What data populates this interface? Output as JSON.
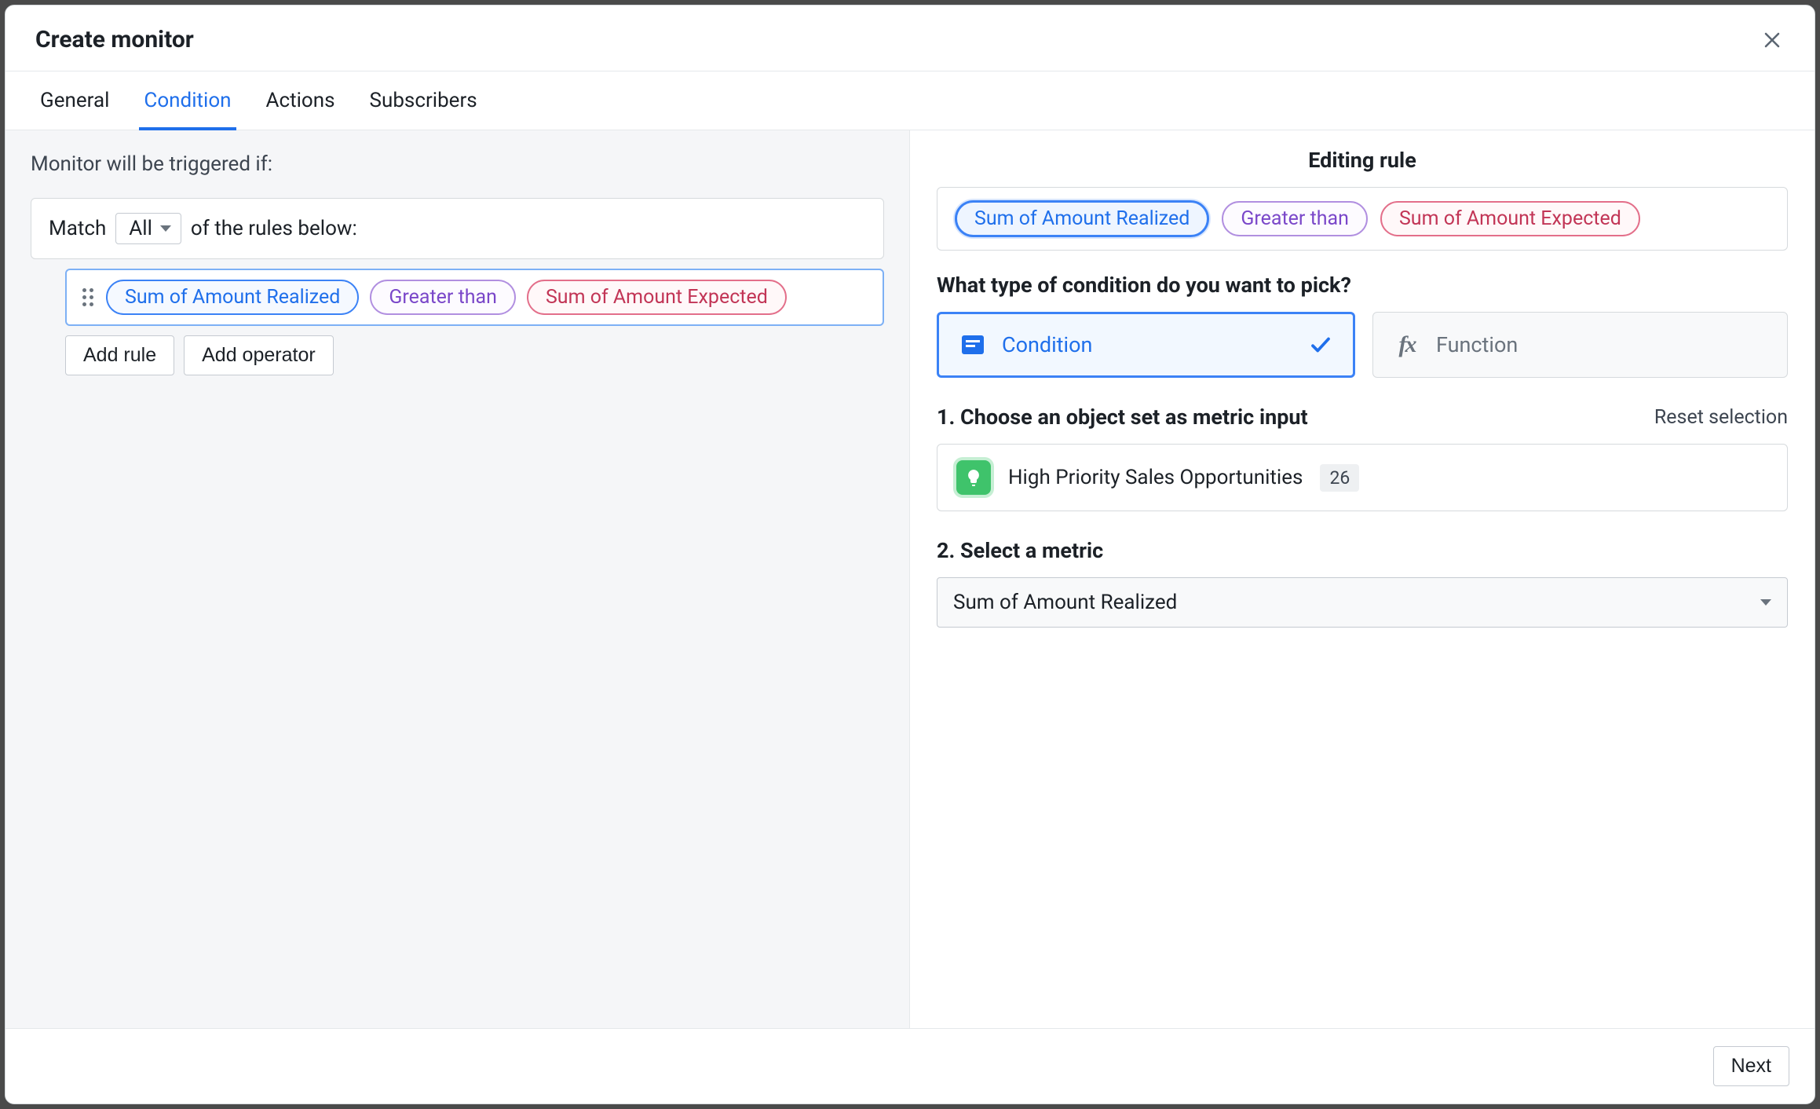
{
  "header": {
    "title": "Create monitor"
  },
  "tabs": [
    "General",
    "Condition",
    "Actions",
    "Subscribers"
  ],
  "active_tab_index": 1,
  "left": {
    "prompt": "Monitor will be triggered if:",
    "match_prefix": "Match",
    "match_value": "All",
    "match_suffix": "of the rules below:",
    "rule": {
      "left": "Sum of Amount Realized",
      "operator": "Greater than",
      "right": "Sum of Amount Expected"
    },
    "add_rule": "Add rule",
    "add_operator": "Add operator"
  },
  "right": {
    "title": "Editing rule",
    "summary": {
      "left": "Sum of Amount Realized",
      "operator": "Greater than",
      "right": "Sum of Amount Expected"
    },
    "question": "What type of condition do you want to pick?",
    "types": {
      "condition": "Condition",
      "function": "Function"
    },
    "step1": "1. Choose an object set as metric input",
    "reset": "Reset selection",
    "object_set": {
      "name": "High Priority Sales Opportunities",
      "count": "26"
    },
    "step2": "2. Select a metric",
    "metric_value": "Sum of Amount Realized"
  },
  "footer": {
    "next": "Next"
  }
}
